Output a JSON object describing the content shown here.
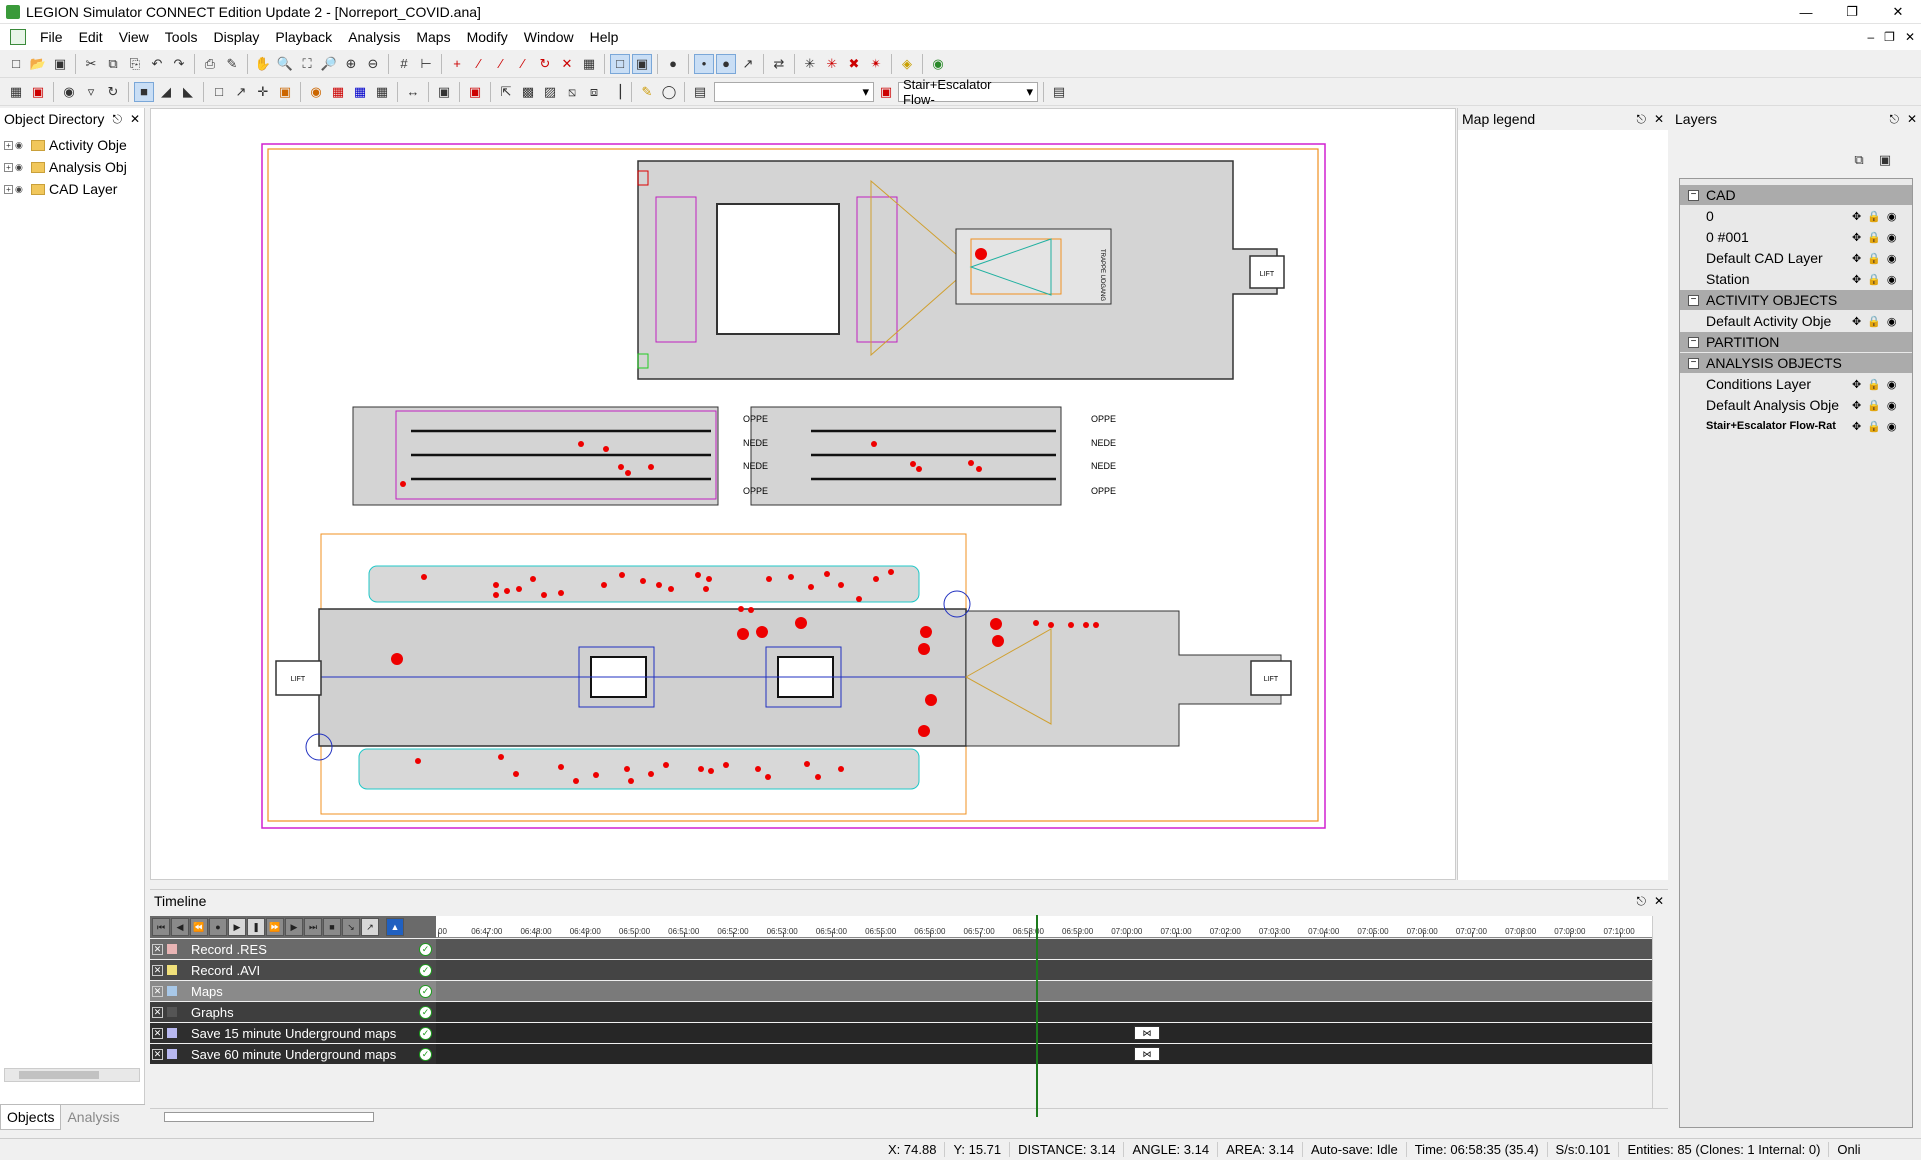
{
  "window": {
    "title": "LEGION Simulator CONNECT Edition Update 2 - [Norreport_COVID.ana]"
  },
  "menu": [
    "File",
    "Edit",
    "View",
    "Tools",
    "Display",
    "Playback",
    "Analysis",
    "Maps",
    "Modify",
    "Window",
    "Help"
  ],
  "toolbar": {
    "layer_combo": "Stair+Escalator Flow-"
  },
  "object_directory": {
    "title": "Object Directory",
    "items": [
      "Activity Obje",
      "Analysis Obj",
      "CAD Layer"
    ],
    "tabs": {
      "objects": "Objects",
      "analysis": "Analysis"
    }
  },
  "map_legend": {
    "title": "Map legend"
  },
  "layers": {
    "title": "Layers",
    "rows": [
      {
        "name": "CAD",
        "header": true
      },
      {
        "name": "0"
      },
      {
        "name": "0 #001"
      },
      {
        "name": "Default CAD Layer"
      },
      {
        "name": "Station"
      },
      {
        "name": "ACTIVITY OBJECTS",
        "header": true
      },
      {
        "name": "Default Activity Obje"
      },
      {
        "name": "PARTITION",
        "header": true
      },
      {
        "name": "ANALYSIS OBJECTS",
        "header": true
      },
      {
        "name": "Conditions Layer"
      },
      {
        "name": "Default Analysis Obje"
      },
      {
        "name": "Stair+Escalator Flow-Rat",
        "bold": true
      }
    ]
  },
  "map": {
    "labels": {
      "lift": "LIFT",
      "trappe": "TRAPPE UDGANG",
      "oppe": "OPPE",
      "nede": "NEDE"
    }
  },
  "timeline": {
    "title": "Timeline",
    "ticks": [
      "00",
      "06:47:00",
      "06:48:00",
      "06:49:00",
      "06:50:00",
      "06:51:00",
      "06:52:00",
      "06:53:00",
      "06:54:00",
      "06:55:00",
      "06:56:00",
      "06:57:00",
      "06:58:00",
      "06:59:00",
      "07:00:00",
      "07:01:00",
      "07:02:00",
      "07:03:00",
      "07:04:00",
      "07:05:00",
      "07:06:00",
      "07:07:00",
      "07:08:00",
      "07:09:00",
      "07:10:00"
    ],
    "rows": [
      {
        "name": "Record .RES",
        "swatch": "#e8b4b4",
        "bg": "#6a6a6a",
        "bar": "#555555"
      },
      {
        "name": "Record .AVI",
        "swatch": "#f0e07a",
        "bg": "#4a4a4a",
        "bar": "#444444"
      },
      {
        "name": "Maps",
        "swatch": "#a8c8e8",
        "bg": "#8a8a8a",
        "bar": "#7a7a7a"
      },
      {
        "name": "Graphs",
        "swatch": "#555555",
        "bg": "#3e3e3e",
        "bar": "#2e2e2e"
      },
      {
        "name": "Save 15 minute Underground maps",
        "swatch": "#b8b8f0",
        "bg": "#2e2e2e",
        "bar": "#262626"
      },
      {
        "name": "Save 60 minute Underground maps",
        "swatch": "#b8b8f0",
        "bg": "#2e2e2e",
        "bar": "#262626"
      }
    ]
  },
  "status": {
    "x": "X: 74.88",
    "y": "Y: 15.71",
    "distance": "DISTANCE: 3.14",
    "angle": "ANGLE: 3.14",
    "area": "AREA: 3.14",
    "autosave": "Auto-save: Idle",
    "time": "Time: 06:58:35 (35.4)",
    "speed": "S/s:0.101",
    "entities": "Entities: 85 (Clones: 1 Internal: 0)",
    "online": "Onli"
  }
}
